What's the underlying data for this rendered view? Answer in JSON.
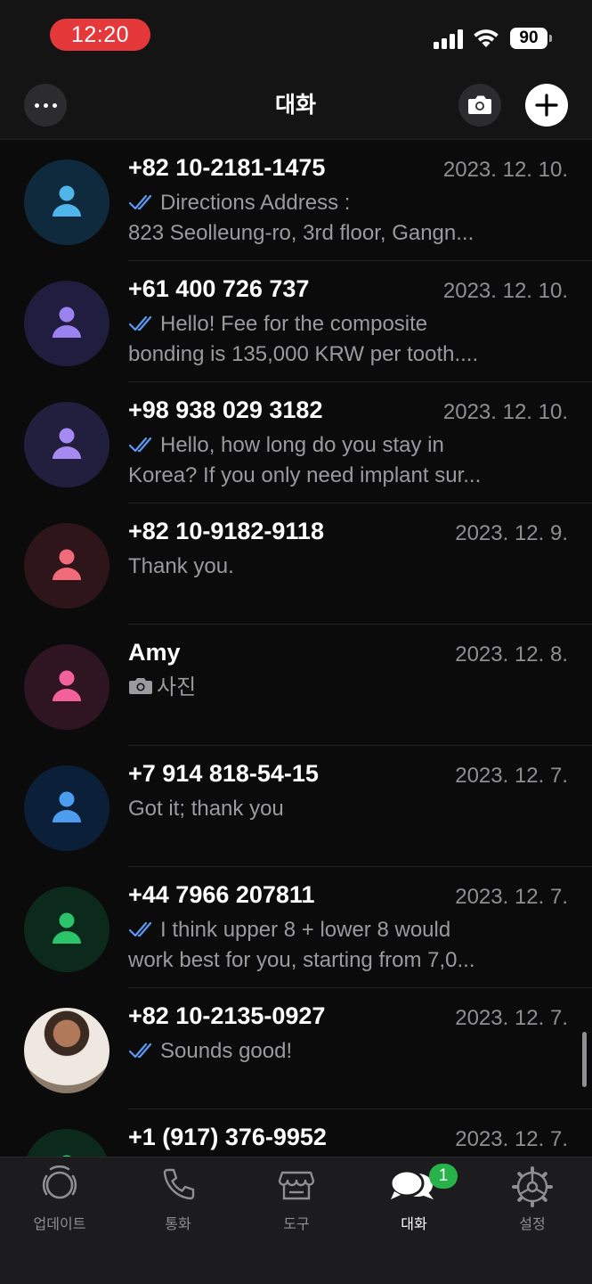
{
  "status_bar": {
    "time": "12:20",
    "battery": "90"
  },
  "header": {
    "title": "대화"
  },
  "chats": [
    {
      "name": "+82 10-2181-1475",
      "date": "2023. 12. 10.",
      "read": true,
      "lines": [
        "Directions Address :",
        "823 Seolleung-ro, 3rd floor, Gangn..."
      ],
      "avatar_bg": "#0e2a3c",
      "avatar_fg": "#4fb5ea"
    },
    {
      "name": "+61 400 726 737",
      "date": "2023. 12. 10.",
      "read": true,
      "lines": [
        "Hello! Fee for the composite",
        "bonding is 135,000 KRW per tooth...."
      ],
      "avatar_bg": "#211d3e",
      "avatar_fg": "#9b82f0"
    },
    {
      "name": "+98 938 029 3182",
      "date": "2023. 12. 10.",
      "read": true,
      "lines": [
        "Hello, how long do you stay in",
        "Korea? If you only need implant sur..."
      ],
      "avatar_bg": "#221e3e",
      "avatar_fg": "#a68af2"
    },
    {
      "name": "+82 10-9182-9118",
      "date": "2023. 12. 9.",
      "read": false,
      "lines": [
        "Thank you."
      ],
      "avatar_bg": "#2e1519",
      "avatar_fg": "#f06a7a"
    },
    {
      "name": "Amy",
      "date": "2023. 12. 8.",
      "read": false,
      "photo": true,
      "lines": [
        "사진"
      ],
      "avatar_bg": "#2f1522",
      "avatar_fg": "#f2619a"
    },
    {
      "name": "+7 914 818-54-15",
      "date": "2023. 12. 7.",
      "read": false,
      "lines": [
        "Got it; thank you"
      ],
      "avatar_bg": "#0c1f38",
      "avatar_fg": "#4c9cf0"
    },
    {
      "name": "+44 7966 207811",
      "date": "2023. 12. 7.",
      "read": true,
      "lines": [
        "I think upper 8 + lower 8 would",
        "work best for you, starting from  7,0..."
      ],
      "avatar_bg": "#0c2a1c",
      "avatar_fg": "#2cc46a"
    },
    {
      "name": "+82 10-2135-0927",
      "date": "2023. 12. 7.",
      "read": true,
      "lines": [
        "Sounds good!"
      ],
      "avatar_bg": "#6a5a4e",
      "avatar_fg": "#e8d8c8",
      "photo_avatar": true
    },
    {
      "name": "+1 (917) 376-9952",
      "date": "2023. 12. 7.",
      "read": false,
      "lines": [
        ""
      ],
      "avatar_bg": "#0c2a1c",
      "avatar_fg": "#2cc46a"
    }
  ],
  "tabs": [
    {
      "label": "업데이트",
      "icon": "updates-icon",
      "active": false
    },
    {
      "label": "통화",
      "icon": "phone-icon",
      "active": false
    },
    {
      "label": "도구",
      "icon": "store-icon",
      "active": false
    },
    {
      "label": "대화",
      "icon": "chats-icon",
      "active": true,
      "badge": "1"
    },
    {
      "label": "설정",
      "icon": "settings-icon",
      "active": false
    }
  ],
  "colors": {
    "read_check": "#5b9bf5",
    "badge": "#25b34a",
    "recording_pill": "#e5383b"
  }
}
